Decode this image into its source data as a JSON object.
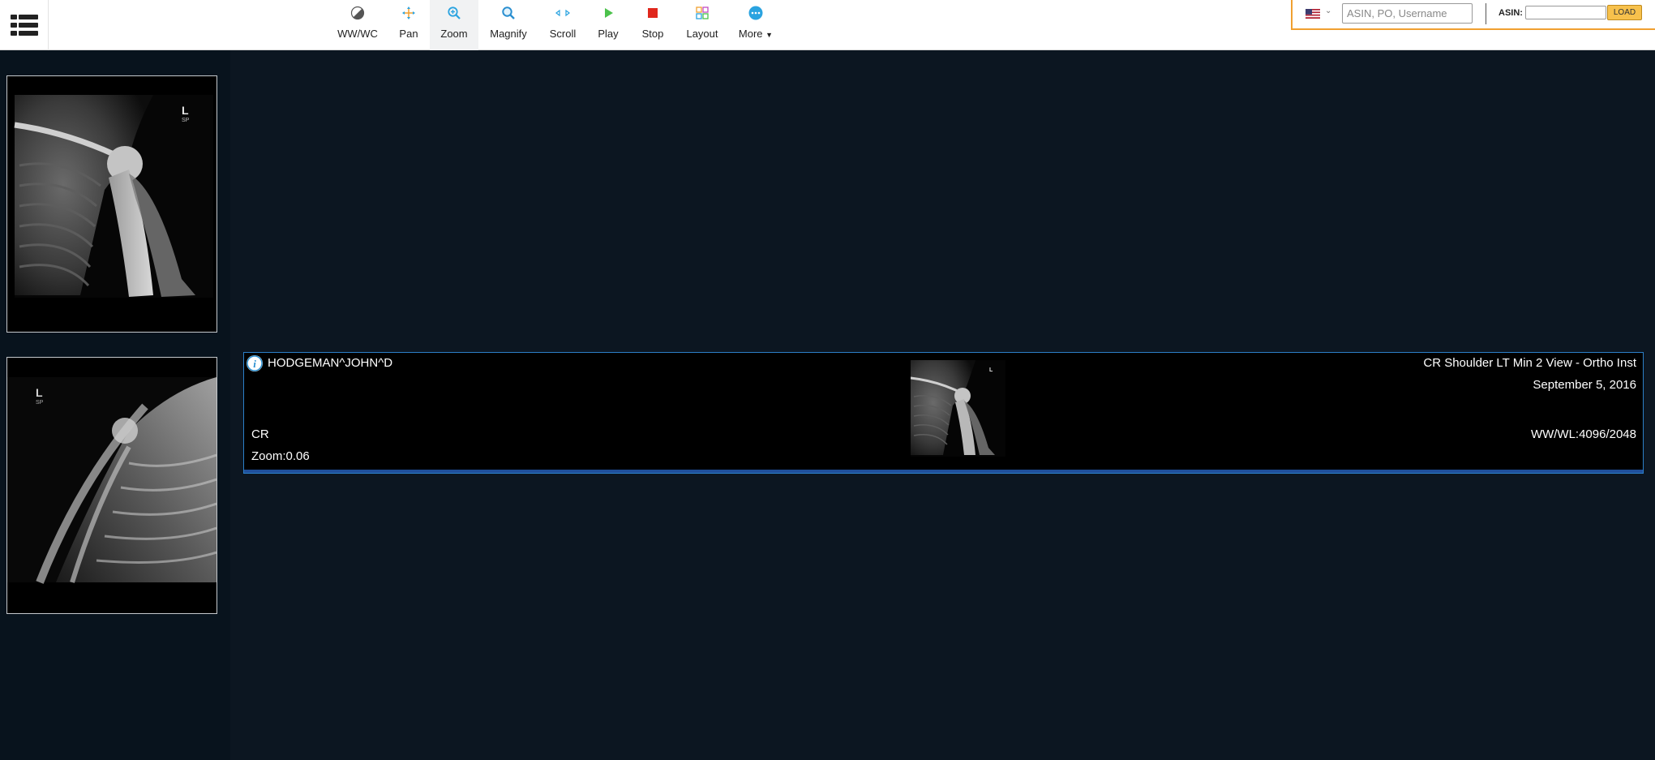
{
  "toolbar": {
    "menu_icon": "menu-icon",
    "tools": [
      {
        "label": "WW/WC",
        "icon": "contrast-icon"
      },
      {
        "label": "Pan",
        "icon": "pan-icon"
      },
      {
        "label": "Zoom",
        "icon": "zoom-icon",
        "active": true
      },
      {
        "label": "Magnify",
        "icon": "magnify-icon"
      },
      {
        "label": "Scroll",
        "icon": "scroll-icon"
      },
      {
        "label": "Play",
        "icon": "play-icon"
      },
      {
        "label": "Stop",
        "icon": "stop-icon"
      },
      {
        "label": "Layout",
        "icon": "layout-icon"
      },
      {
        "label": "More",
        "icon": "more-icon"
      }
    ]
  },
  "search": {
    "placeholder": "ASIN, PO, Username",
    "asin_label": "ASIN:",
    "asin_value": "",
    "load_label": "LOAD",
    "flag_icon": "us-flag-icon"
  },
  "viewport": {
    "patient": "HODGEMAN^JOHN^D",
    "study": "CR Shoulder LT Min 2 View - Ortho Inst",
    "date": "September 5, 2016",
    "modality": "CR",
    "zoom": "Zoom:0.06",
    "wwwl": "WW/WL:4096/2048"
  },
  "colors": {
    "accent_blue": "#2c7fc8",
    "viewer_bg": "#0c1621",
    "panel_bg": "#08131d",
    "load_button": "#f7c14c",
    "search_border": "#f0a030"
  }
}
